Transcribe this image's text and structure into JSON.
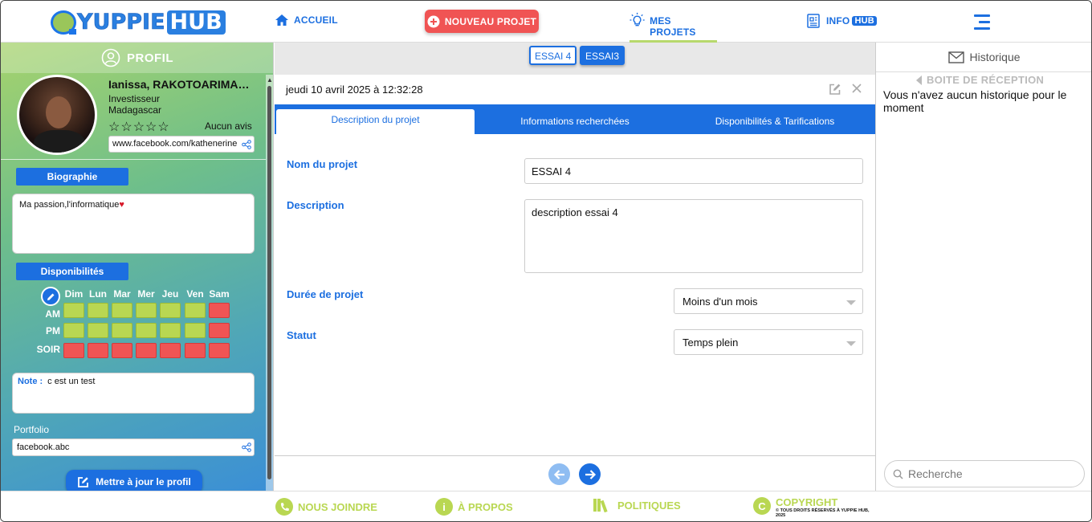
{
  "brand": {
    "logo_left": "YUPPIE",
    "logo_right": "HUB"
  },
  "nav": {
    "accueil": "ACCUEIL",
    "nouveau_projet": "NOUVEAU PROJET",
    "mes_projets": "MES PROJETS",
    "info": "INFO",
    "info_hub": "HUB"
  },
  "profile": {
    "header": "PROFIL",
    "name": "Ianissa, RAKOTOARIMANANA",
    "role": "Investisseur",
    "country": "Madagascar",
    "stars": "☆☆☆☆☆",
    "reviews": "Aucun avis",
    "facebook": "www.facebook.com/kathenerine",
    "bio_label": "Biographie",
    "bio": "Ma passion,l'informatique",
    "dispo_label": "Disponibilités",
    "days": [
      "Dim",
      "Lun",
      "Mar",
      "Mer",
      "Jeu",
      "Ven",
      "Sam"
    ],
    "slots": [
      "AM",
      "PM",
      "SOIR"
    ],
    "availability": {
      "AM": [
        "available",
        "available",
        "available",
        "available",
        "available",
        "available",
        "unavailable"
      ],
      "PM": [
        "available",
        "available",
        "available",
        "available",
        "available",
        "available",
        "unavailable"
      ],
      "SOIR": [
        "unavailable",
        "unavailable",
        "unavailable",
        "unavailable",
        "unavailable",
        "unavailable",
        "unavailable"
      ]
    },
    "note_label": "Note :",
    "note": "c est un test",
    "portfolio_label": "Portfolio",
    "portfolio": "facebook.abc",
    "update_button": "Mettre à jour le profil"
  },
  "projects": {
    "tabs": [
      "ESSAI 4",
      "ESSAI3"
    ],
    "active_tab": "ESSAI 4",
    "date": "jeudi 10 avril 2025 à 12:32:28",
    "section_tabs": [
      "Description du projet",
      "Informations recherchées",
      "Disponibilités & Tarifications"
    ],
    "form": {
      "name_label": "Nom du projet",
      "name_value": "ESSAI 4",
      "desc_label": "Description",
      "desc_value": "description essai 4",
      "duration_label": "Durée de projet",
      "duration_value": "Moins d'un mois",
      "status_label": "Statut",
      "status_value": "Temps plein"
    }
  },
  "history": {
    "header": "Historique",
    "inbox": "BOITE DE RÉCEPTION",
    "empty": "Vous n'avez aucun historique pour le moment",
    "search_placeholder": "Recherche"
  },
  "footer": {
    "contact": "NOUS JOINDRE",
    "about": "À PROPOS",
    "policies": "POLITIQUES",
    "copyright": "COPYRIGHT",
    "copyright_note": "© TOUS DROITS RÉSERVÉS À YUPPIE HUB, 2025"
  },
  "colors": {
    "primary": "#1c6fe0",
    "accent_green": "#b9d752",
    "danger": "#f05454"
  }
}
